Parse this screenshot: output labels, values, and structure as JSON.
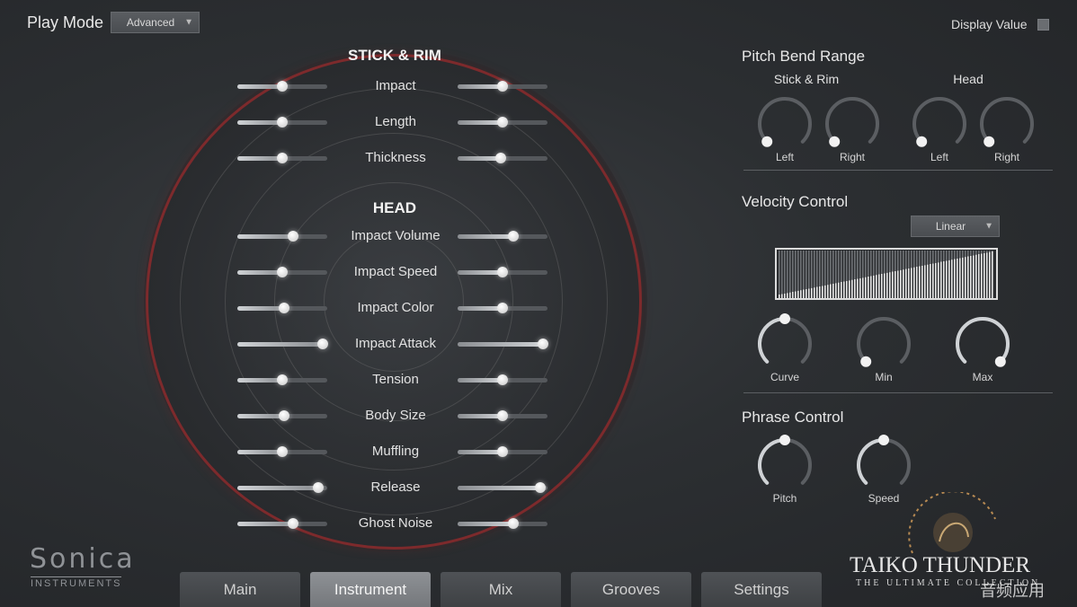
{
  "header": {
    "play_mode_label": "Play Mode",
    "play_mode_value": "Advanced",
    "display_value_label": "Display Value"
  },
  "stick_rim": {
    "title": "STICK & RIM",
    "sliders": [
      {
        "label": "Impact",
        "left": 0.5,
        "right": 0.5
      },
      {
        "label": "Length",
        "left": 0.5,
        "right": 0.5
      },
      {
        "label": "Thickness",
        "left": 0.5,
        "right": 0.48
      }
    ]
  },
  "head": {
    "title": "HEAD",
    "sliders": [
      {
        "label": "Impact Volume",
        "left": 0.62,
        "right": 0.62
      },
      {
        "label": "Impact Speed",
        "left": 0.5,
        "right": 0.5
      },
      {
        "label": "Impact Color",
        "left": 0.52,
        "right": 0.5
      },
      {
        "label": "Impact Attack",
        "left": 0.95,
        "right": 0.95
      },
      {
        "label": "Tension",
        "left": 0.5,
        "right": 0.5
      },
      {
        "label": "Body Size",
        "left": 0.52,
        "right": 0.5
      },
      {
        "label": "Muffling",
        "left": 0.5,
        "right": 0.5
      },
      {
        "label": "Release",
        "left": 0.9,
        "right": 0.92
      },
      {
        "label": "Ghost Noise",
        "left": 0.62,
        "right": 0.62
      }
    ]
  },
  "pitch_bend": {
    "title": "Pitch Bend Range",
    "groups": [
      {
        "title": "Stick & Rim",
        "knobs": [
          {
            "label": "Left",
            "value": 0.0
          },
          {
            "label": "Right",
            "value": 0.0
          }
        ]
      },
      {
        "title": "Head",
        "knobs": [
          {
            "label": "Left",
            "value": 0.0
          },
          {
            "label": "Right",
            "value": 0.0
          }
        ]
      }
    ]
  },
  "velocity": {
    "title": "Velocity Control",
    "curve_type": "Linear",
    "knobs": [
      {
        "label": "Curve",
        "value": 0.5
      },
      {
        "label": "Min",
        "value": 0.0
      },
      {
        "label": "Max",
        "value": 1.0
      }
    ]
  },
  "phrase": {
    "title": "Phrase Control",
    "knobs": [
      {
        "label": "Pitch",
        "value": 0.5
      },
      {
        "label": "Speed",
        "value": 0.5
      }
    ]
  },
  "tabs": [
    {
      "label": "Main",
      "active": false
    },
    {
      "label": "Instrument",
      "active": true
    },
    {
      "label": "Mix",
      "active": false
    },
    {
      "label": "Grooves",
      "active": false
    },
    {
      "label": "Settings",
      "active": false
    }
  ],
  "branding": {
    "sonica": "Sonica",
    "sonica_sub": "INSTRUMENTS",
    "product": "TAIKO THUNDER",
    "product_sub": "THE ULTIMATE COLLECTION",
    "watermark": "音频应用"
  },
  "colors": {
    "accent_ring": "#7d2a2c",
    "active_tab": "#8e9195"
  }
}
